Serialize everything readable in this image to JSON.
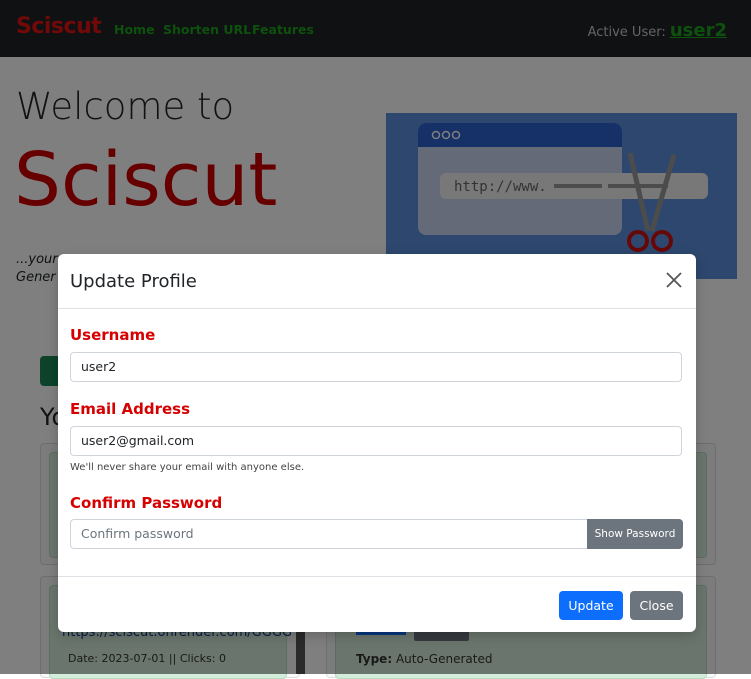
{
  "navbar": {
    "brand": "Sciscut",
    "links": [
      "Home",
      "Shorten URL",
      "Features"
    ],
    "active_user_label": "Active User:",
    "active_user_name": "user2"
  },
  "hero": {
    "welcome": "Welcome to",
    "name": "Sciscut",
    "tagline_line1": "...your",
    "tagline_line2": "Gener",
    "image_url_text": "http://www."
  },
  "links_section": {
    "title_fragment": "Yo",
    "card_url": "https://sciscut.onrender.com/GGGG",
    "card_meta": "Date: 2023-07-01 || Clicks: 0",
    "type_label": "Type:",
    "type_value": "Auto-Generated"
  },
  "modal": {
    "title": "Update Profile",
    "username_label": "Username",
    "username_value": "user2",
    "email_label": "Email Address",
    "email_value": "user2@gmail.com",
    "email_help": "We'll never share your email with anyone else.",
    "password_label": "Confirm Password",
    "password_placeholder": "Confirm password",
    "show_password": "Show Password",
    "update_button": "Update",
    "close_button": "Close"
  },
  "colors": {
    "brand_red": "#e31212",
    "nav_green": "#1aa31a",
    "primary": "#0d6efd",
    "secondary": "#6c757d"
  }
}
